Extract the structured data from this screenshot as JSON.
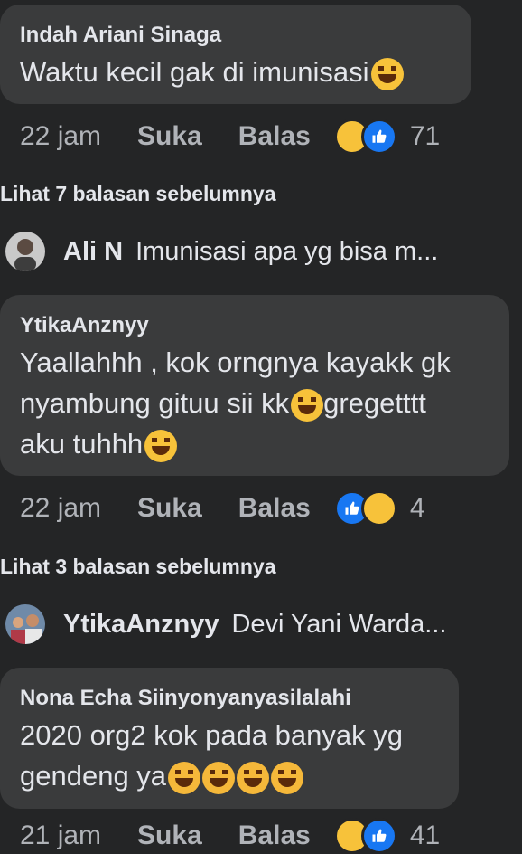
{
  "comments": [
    {
      "author": "Indah Ariani Sinaga",
      "text": "Waktu kecil gak di imunisasi",
      "time": "22 jam",
      "like_label": "Suka",
      "reply_label": "Balas",
      "reaction_count": "71"
    },
    {
      "author": "YtikaAnznyy",
      "line1": "Yaallahhh , kok orngnya kayakk gk",
      "line2a": "nyambung gituu sii kk",
      "line2b": "gregetttt",
      "line3": "aku tuhhh",
      "time": "22 jam",
      "like_label": "Suka",
      "reply_label": "Balas",
      "reaction_count": "4"
    },
    {
      "author": "Nona Echa Siinyonyanyasilalahi",
      "line1": "2020 org2 kok pada banyak yg",
      "line2": "gendeng ya",
      "time": "21 jam",
      "like_label": "Suka",
      "reply_label": "Balas",
      "reaction_count": "41"
    }
  ],
  "see_more": [
    "Lihat 7 balasan sebelumnya",
    "Lihat 3 balasan sebelumnya"
  ],
  "collapsed_replies": [
    {
      "name": "Ali N",
      "snippet": "Imunisasi apa yg bisa m...",
      "avatar_icon": "avatar-person"
    },
    {
      "name": "YtikaAnznyy",
      "snippet": "Devi Yani Warda...",
      "avatar_icon": "avatar-group"
    }
  ],
  "colors": {
    "background": "#242526",
    "bubble": "#3a3b3c",
    "text": "#e4e6eb",
    "secondary_text": "#b0b3b8",
    "like_blue": "#1877f2",
    "haha_yellow": "#f7c23a"
  }
}
